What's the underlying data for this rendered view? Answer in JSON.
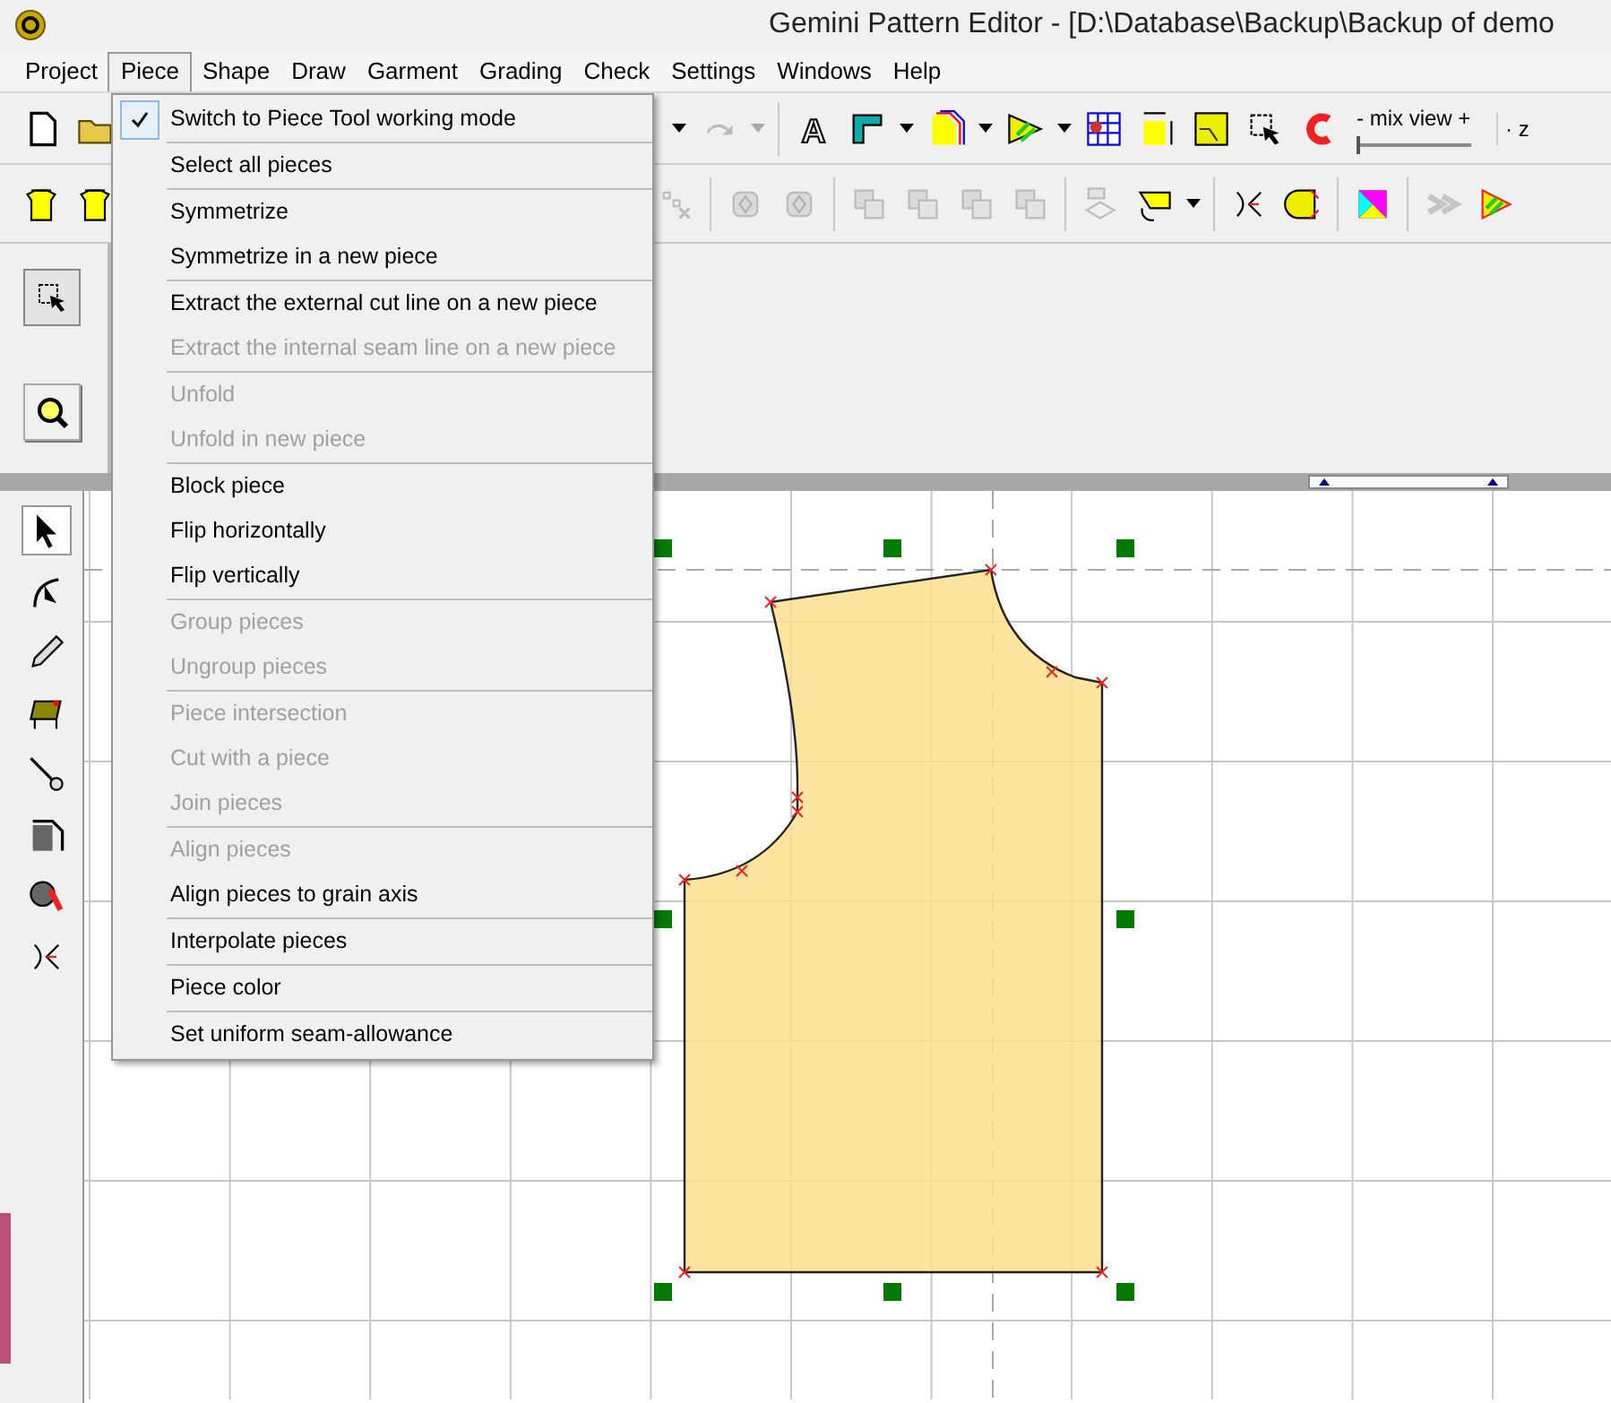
{
  "window": {
    "title": "Gemini Pattern Editor - [D:\\Database\\Backup\\Backup of demo"
  },
  "menu_bar": [
    {
      "label": "Project",
      "selected": false
    },
    {
      "label": "Piece",
      "selected": true
    },
    {
      "label": "Shape",
      "selected": false
    },
    {
      "label": "Draw",
      "selected": false
    },
    {
      "label": "Garment",
      "selected": false
    },
    {
      "label": "Grading",
      "selected": false
    },
    {
      "label": "Check",
      "selected": false
    },
    {
      "label": "Settings",
      "selected": false
    },
    {
      "label": "Windows",
      "selected": false
    },
    {
      "label": "Help",
      "selected": false
    }
  ],
  "toolbar_1": {
    "left": [
      {
        "kind": "file",
        "disabled": false
      },
      {
        "kind": "folder",
        "disabled": false
      }
    ],
    "right": [
      {
        "kind": "caret",
        "disabled": false
      },
      {
        "kind": "redo",
        "disabled": true
      },
      {
        "kind": "caret",
        "disabled": true
      },
      {
        "kind": "sep"
      },
      {
        "kind": "text",
        "glyph": "A",
        "disabled": false
      },
      {
        "kind": "ruler",
        "disabled": false
      },
      {
        "kind": "caret",
        "disabled": false
      },
      {
        "kind": "outline",
        "disabled": false
      },
      {
        "kind": "caret",
        "disabled": false
      },
      {
        "kind": "arrow",
        "disabled": false
      },
      {
        "kind": "caret",
        "disabled": false
      },
      {
        "kind": "grid",
        "disabled": false
      },
      {
        "kind": "measure",
        "disabled": false
      },
      {
        "kind": "piece",
        "disabled": false
      },
      {
        "kind": "select",
        "disabled": false
      },
      {
        "kind": "magnet",
        "disabled": false
      }
    ],
    "mix_view": {
      "label": "- mix view +",
      "level": 0.0
    },
    "zoom_label": "·  z"
  },
  "toolbar_2": {
    "left": [
      {
        "kind": "shirt",
        "disabled": false
      },
      {
        "kind": "shirt",
        "disabled": false
      }
    ],
    "right": [
      {
        "kind": "points",
        "disabled": true
      },
      {
        "kind": "sep"
      },
      {
        "kind": "dotted",
        "disabled": true
      },
      {
        "kind": "dotted",
        "disabled": true
      },
      {
        "kind": "sep"
      },
      {
        "kind": "copy",
        "disabled": true
      },
      {
        "kind": "copy",
        "disabled": true
      },
      {
        "kind": "copy",
        "disabled": true
      },
      {
        "kind": "copy",
        "disabled": true
      },
      {
        "kind": "sep"
      },
      {
        "kind": "flag",
        "disabled": true
      },
      {
        "kind": "fold",
        "disabled": false
      },
      {
        "kind": "caret",
        "disabled": false
      },
      {
        "kind": "sep"
      },
      {
        "kind": "nodes",
        "disabled": false
      },
      {
        "kind": "half",
        "disabled": false
      },
      {
        "kind": "sep"
      },
      {
        "kind": "color",
        "disabled": false
      },
      {
        "kind": "sep"
      },
      {
        "kind": "mirror",
        "disabled": true
      },
      {
        "kind": "stripes",
        "disabled": false
      }
    ]
  },
  "side_tools": [
    {
      "kind": "select",
      "selected": true
    },
    {
      "kind": "zoom",
      "selected": false
    }
  ],
  "tools": [
    {
      "kind": "pointer",
      "selected": true
    },
    {
      "kind": "curve",
      "selected": false
    },
    {
      "kind": "pencil",
      "selected": false
    },
    {
      "kind": "table",
      "selected": false
    },
    {
      "kind": "pin",
      "selected": false
    },
    {
      "kind": "pattern",
      "selected": false
    },
    {
      "kind": "tape",
      "selected": false
    },
    {
      "kind": "nodes",
      "selected": false
    }
  ],
  "piece_menu": {
    "groups": [
      [
        {
          "label": "Switch to Piece Tool working mode",
          "checked": true,
          "disabled": false
        }
      ],
      [
        {
          "label": "Select all pieces",
          "checked": false,
          "disabled": false
        }
      ],
      [
        {
          "label": "Symmetrize",
          "checked": false,
          "disabled": false
        },
        {
          "label": "Symmetrize in a new piece",
          "checked": false,
          "disabled": false
        }
      ],
      [
        {
          "label": "Extract the external cut line on a new piece",
          "checked": false,
          "disabled": false
        },
        {
          "label": "Extract the internal seam line on a new piece",
          "checked": false,
          "disabled": true
        }
      ],
      [
        {
          "label": "Unfold",
          "checked": false,
          "disabled": true
        },
        {
          "label": "Unfold in new piece",
          "checked": false,
          "disabled": true
        }
      ],
      [
        {
          "label": "Block piece",
          "checked": false,
          "disabled": false
        },
        {
          "label": "Flip horizontally",
          "checked": false,
          "disabled": false
        },
        {
          "label": "Flip vertically",
          "checked": false,
          "disabled": false
        }
      ],
      [
        {
          "label": "Group pieces",
          "checked": false,
          "disabled": true
        },
        {
          "label": "Ungroup pieces",
          "checked": false,
          "disabled": true
        }
      ],
      [
        {
          "label": "Piece intersection",
          "checked": false,
          "disabled": true
        },
        {
          "label": "Cut with a piece",
          "checked": false,
          "disabled": true
        },
        {
          "label": "Join pieces",
          "checked": false,
          "disabled": true
        }
      ],
      [
        {
          "label": "Align pieces",
          "checked": false,
          "disabled": true
        },
        {
          "label": "Align pieces to grain axis",
          "checked": false,
          "disabled": false
        }
      ],
      [
        {
          "label": "Interpolate pieces",
          "checked": false,
          "disabled": false
        }
      ],
      [
        {
          "label": "Piece color",
          "checked": false,
          "disabled": false
        }
      ],
      [
        {
          "label": "Set uniform seam-allowance",
          "checked": false,
          "disabled": false
        }
      ]
    ]
  }
}
